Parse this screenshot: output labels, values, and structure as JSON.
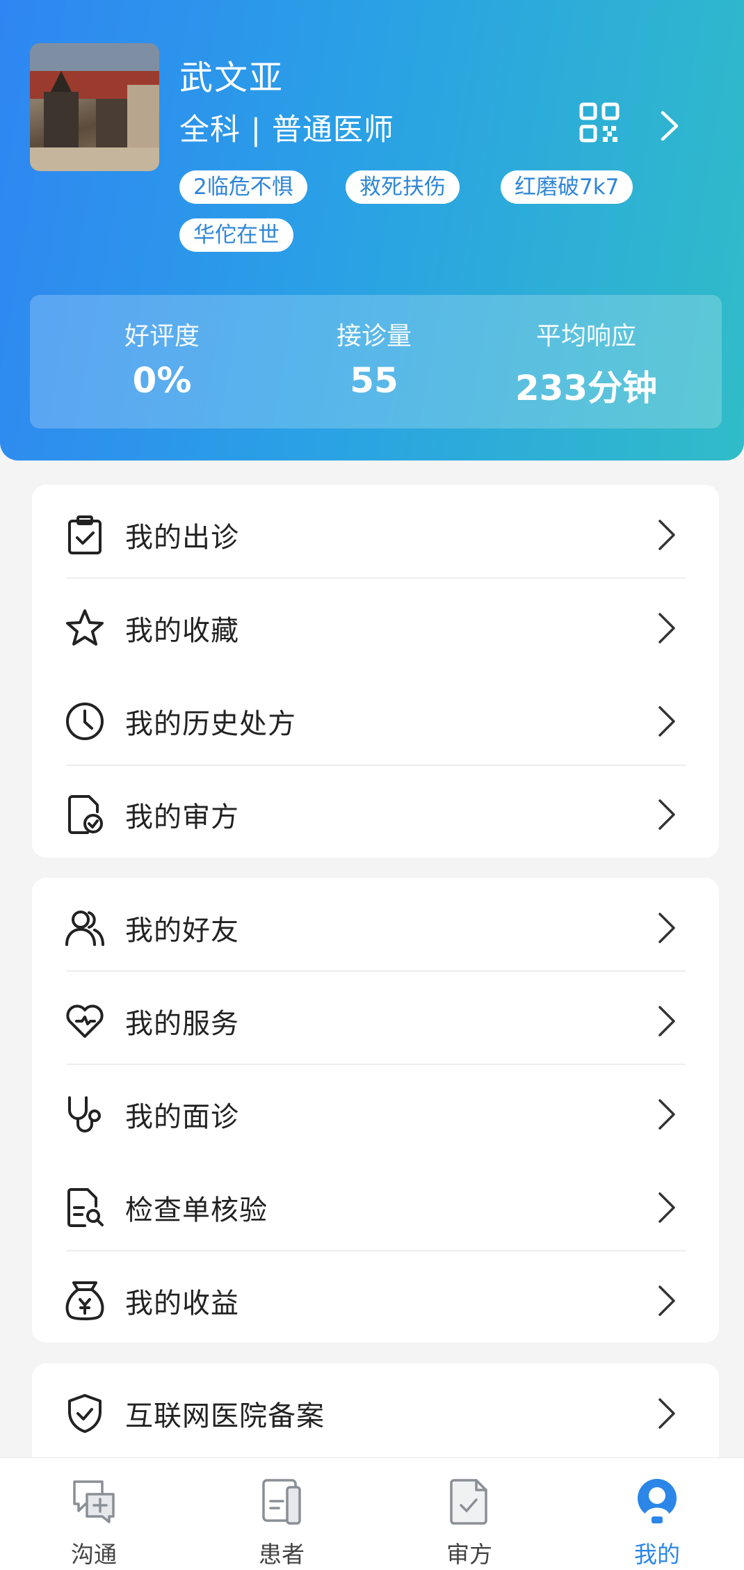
{
  "profile": {
    "name": "武文亚",
    "title": "全科 |  普通医师",
    "tags": [
      "2临危不惧",
      "救死扶伤",
      "红磨破7k7",
      "华佗在世"
    ]
  },
  "stats": [
    {
      "label": "好评度",
      "value": "0%"
    },
    {
      "label": "接诊量",
      "value": "55"
    },
    {
      "label": "平均响应",
      "value": "233分钟"
    }
  ],
  "menu_group_1": [
    {
      "label": "我的出诊",
      "icon": "clipboard-check-icon"
    },
    {
      "label": "我的收藏",
      "icon": "star-icon"
    },
    {
      "label": "我的历史处方",
      "icon": "clock-icon"
    },
    {
      "label": "我的审方",
      "icon": "document-check-icon"
    }
  ],
  "menu_group_2": [
    {
      "label": "我的好友",
      "icon": "users-icon"
    },
    {
      "label": "我的服务",
      "icon": "heart-icon"
    },
    {
      "label": "我的面诊",
      "icon": "stethoscope-icon"
    },
    {
      "label": "检查单核验",
      "icon": "document-search-icon"
    },
    {
      "label": "我的收益",
      "icon": "money-bag-icon"
    }
  ],
  "menu_group_3": [
    {
      "label": "互联网医院备案",
      "icon": "shield-check-icon"
    }
  ],
  "tabbar": [
    {
      "label": "沟通",
      "icon": "chat-plus-icon",
      "active": false
    },
    {
      "label": "患者",
      "icon": "patient-card-icon",
      "active": false
    },
    {
      "label": "审方",
      "icon": "prescription-icon",
      "active": false
    },
    {
      "label": "我的",
      "icon": "user-profile-icon",
      "active": true
    }
  ],
  "colors": {
    "header_start": "#2f86f2",
    "header_end": "#30bcc8",
    "tag_text": "#2f86d8",
    "active_tab": "#2b86e8"
  }
}
